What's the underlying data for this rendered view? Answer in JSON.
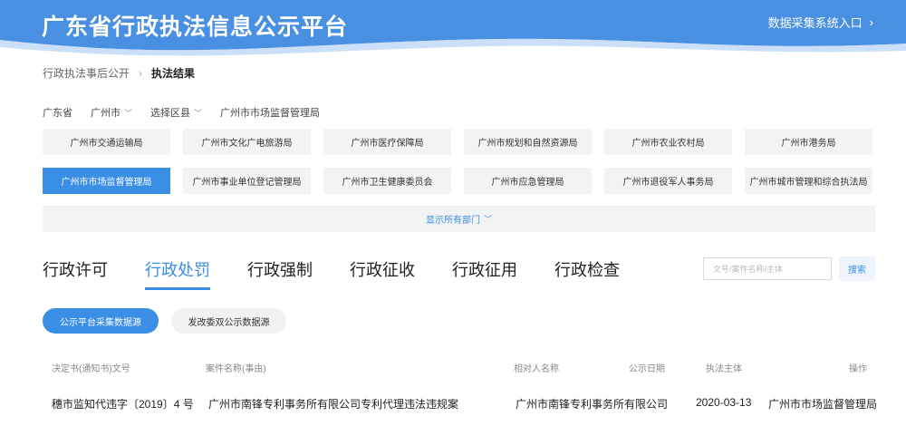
{
  "header": {
    "title": "广东省行政执法信息公示平台",
    "entry_label": "数据采集系统入口",
    "entry_icon": "chevron-right-icon",
    "bg_color": "#4a90e2"
  },
  "breadcrumb": {
    "parent": "行政执法事后公开",
    "current": "执法结果"
  },
  "region": {
    "province": "广东省",
    "city": "广州市",
    "district": "选择区县",
    "department": "广州市市场监督管理局"
  },
  "departments": [
    "广州市交通运输局",
    "广州市文化广电旅游局",
    "广州市医疗保障局",
    "广州市规划和自然资源局",
    "广州市农业农村局",
    "广州市港务局",
    "广州市市场监督管理局",
    "广州市事业单位登记管理局",
    "广州市卫生健康委员会",
    "广州市应急管理局",
    "广州市退役军人事务局",
    "广州市城市管理和综合执法局"
  ],
  "active_department_index": 6,
  "show_all_label": "显示所有部门",
  "tabs": [
    "行政许可",
    "行政处罚",
    "行政强制",
    "行政征收",
    "行政征用",
    "行政检查"
  ],
  "active_tab_index": 1,
  "search": {
    "placeholder": "文号/案件名称/主体",
    "button_label": "搜索"
  },
  "sources": {
    "primary": "公示平台采集数据源",
    "secondary": "发改委双公示数据源"
  },
  "table": {
    "columns": [
      "决定书(通知书)文号",
      "案件名称(事由)",
      "相对人名称",
      "公示日期",
      "执法主体",
      "操作"
    ],
    "rows": [
      [
        "穗市监知代违字〔2019〕4 号",
        "广州市南锋专利事务所有限公司专利代理违法违规案",
        "广州市南锋专利事务所有限公司",
        "2020-03-13",
        "广州市市场监督管理局",
        ""
      ]
    ]
  },
  "accent_color": "#3a8ee6"
}
